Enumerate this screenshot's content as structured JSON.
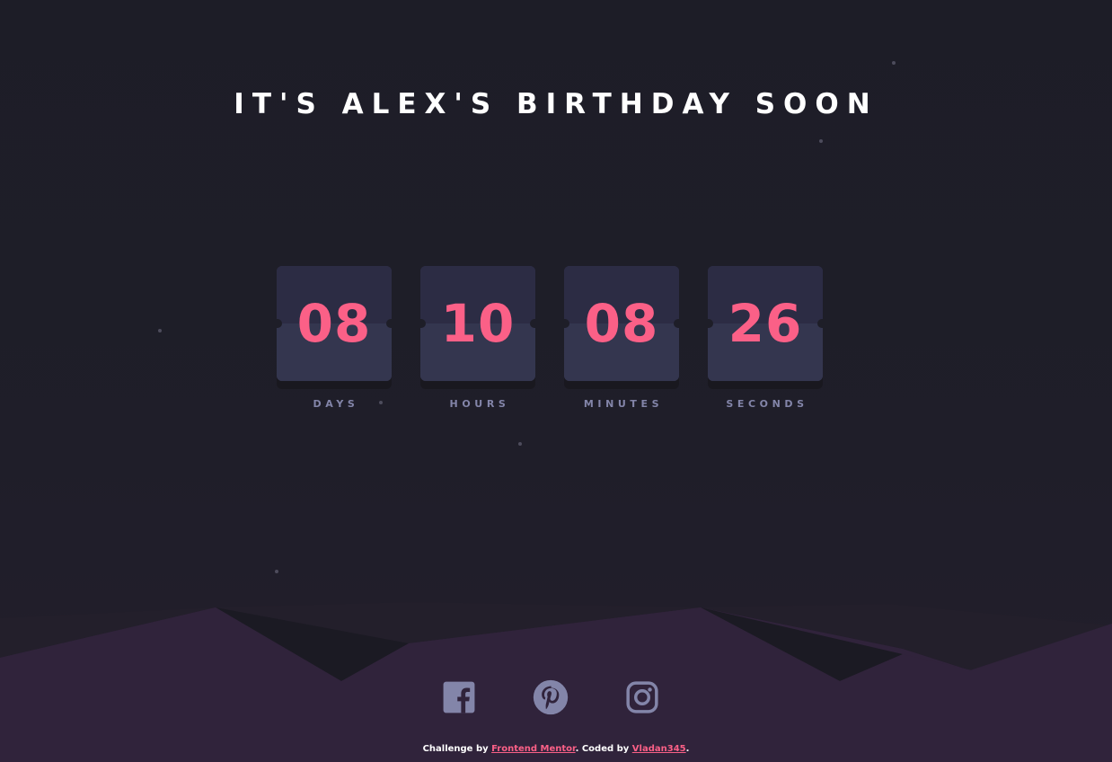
{
  "header": {
    "title": "IT'S ALEX'S BIRTHDAY SOON"
  },
  "countdown": [
    {
      "value": "08",
      "label": "DAYS"
    },
    {
      "value": "10",
      "label": "HOURS"
    },
    {
      "value": "08",
      "label": "MINUTES"
    },
    {
      "value": "26",
      "label": "SECONDS"
    }
  ],
  "socials": [
    {
      "icon": "facebook-icon"
    },
    {
      "icon": "pinterest-icon"
    },
    {
      "icon": "instagram-icon"
    }
  ],
  "footer": {
    "prefix": "Challenge by ",
    "link1": "Frontend Mentor",
    "middle": ". Coded by ",
    "link2": "Vladan345",
    "suffix": "."
  },
  "colors": {
    "background": "#1e1e28",
    "accent": "#fb6087",
    "card": "#343650",
    "label": "#8385a9",
    "hills": "#30233b"
  }
}
